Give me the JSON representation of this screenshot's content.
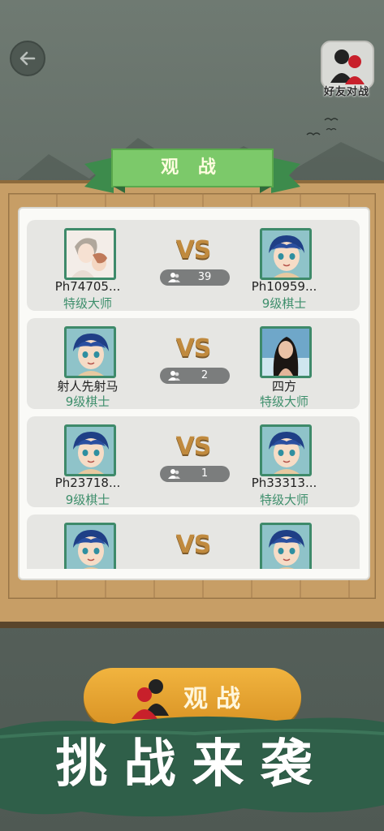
{
  "header": {
    "back_icon": "arrow-left-icon",
    "friend_battle_label": "好友对战"
  },
  "banner": {
    "title": "观 战"
  },
  "matches": [
    {
      "left": {
        "name": "Ph74705...",
        "rank": "特级大师",
        "avatar": "sketch-couple"
      },
      "vs": "VS",
      "viewers": "39",
      "right": {
        "name": "Ph10959...",
        "rank": "9级棋士",
        "avatar": "blue-hair-girl"
      }
    },
    {
      "left": {
        "name": "射人先射马",
        "rank": "9级棋士",
        "avatar": "blue-hair-girl"
      },
      "vs": "VS",
      "viewers": "2",
      "right": {
        "name": "四方",
        "rank": "特级大师",
        "avatar": "photo-woman"
      }
    },
    {
      "left": {
        "name": "Ph23718...",
        "rank": "9级棋士",
        "avatar": "blue-hair-girl"
      },
      "vs": "VS",
      "viewers": "1",
      "right": {
        "name": "Ph33313...",
        "rank": "特级大师",
        "avatar": "blue-hair-girl"
      }
    },
    {
      "left": {
        "name": "",
        "rank": "",
        "avatar": "blue-hair-girl"
      },
      "vs": "VS",
      "viewers": "",
      "right": {
        "name": "",
        "rank": "",
        "avatar": "blue-hair-girl"
      }
    }
  ],
  "watch_button": {
    "label": "观战"
  },
  "promo": {
    "text": "挑战来袭"
  },
  "colors": {
    "rank_green": "#3e8f6c",
    "banner_green": "#7cc96a",
    "button_orange": "#e6a433",
    "vs_gold": "#c08a3e"
  }
}
